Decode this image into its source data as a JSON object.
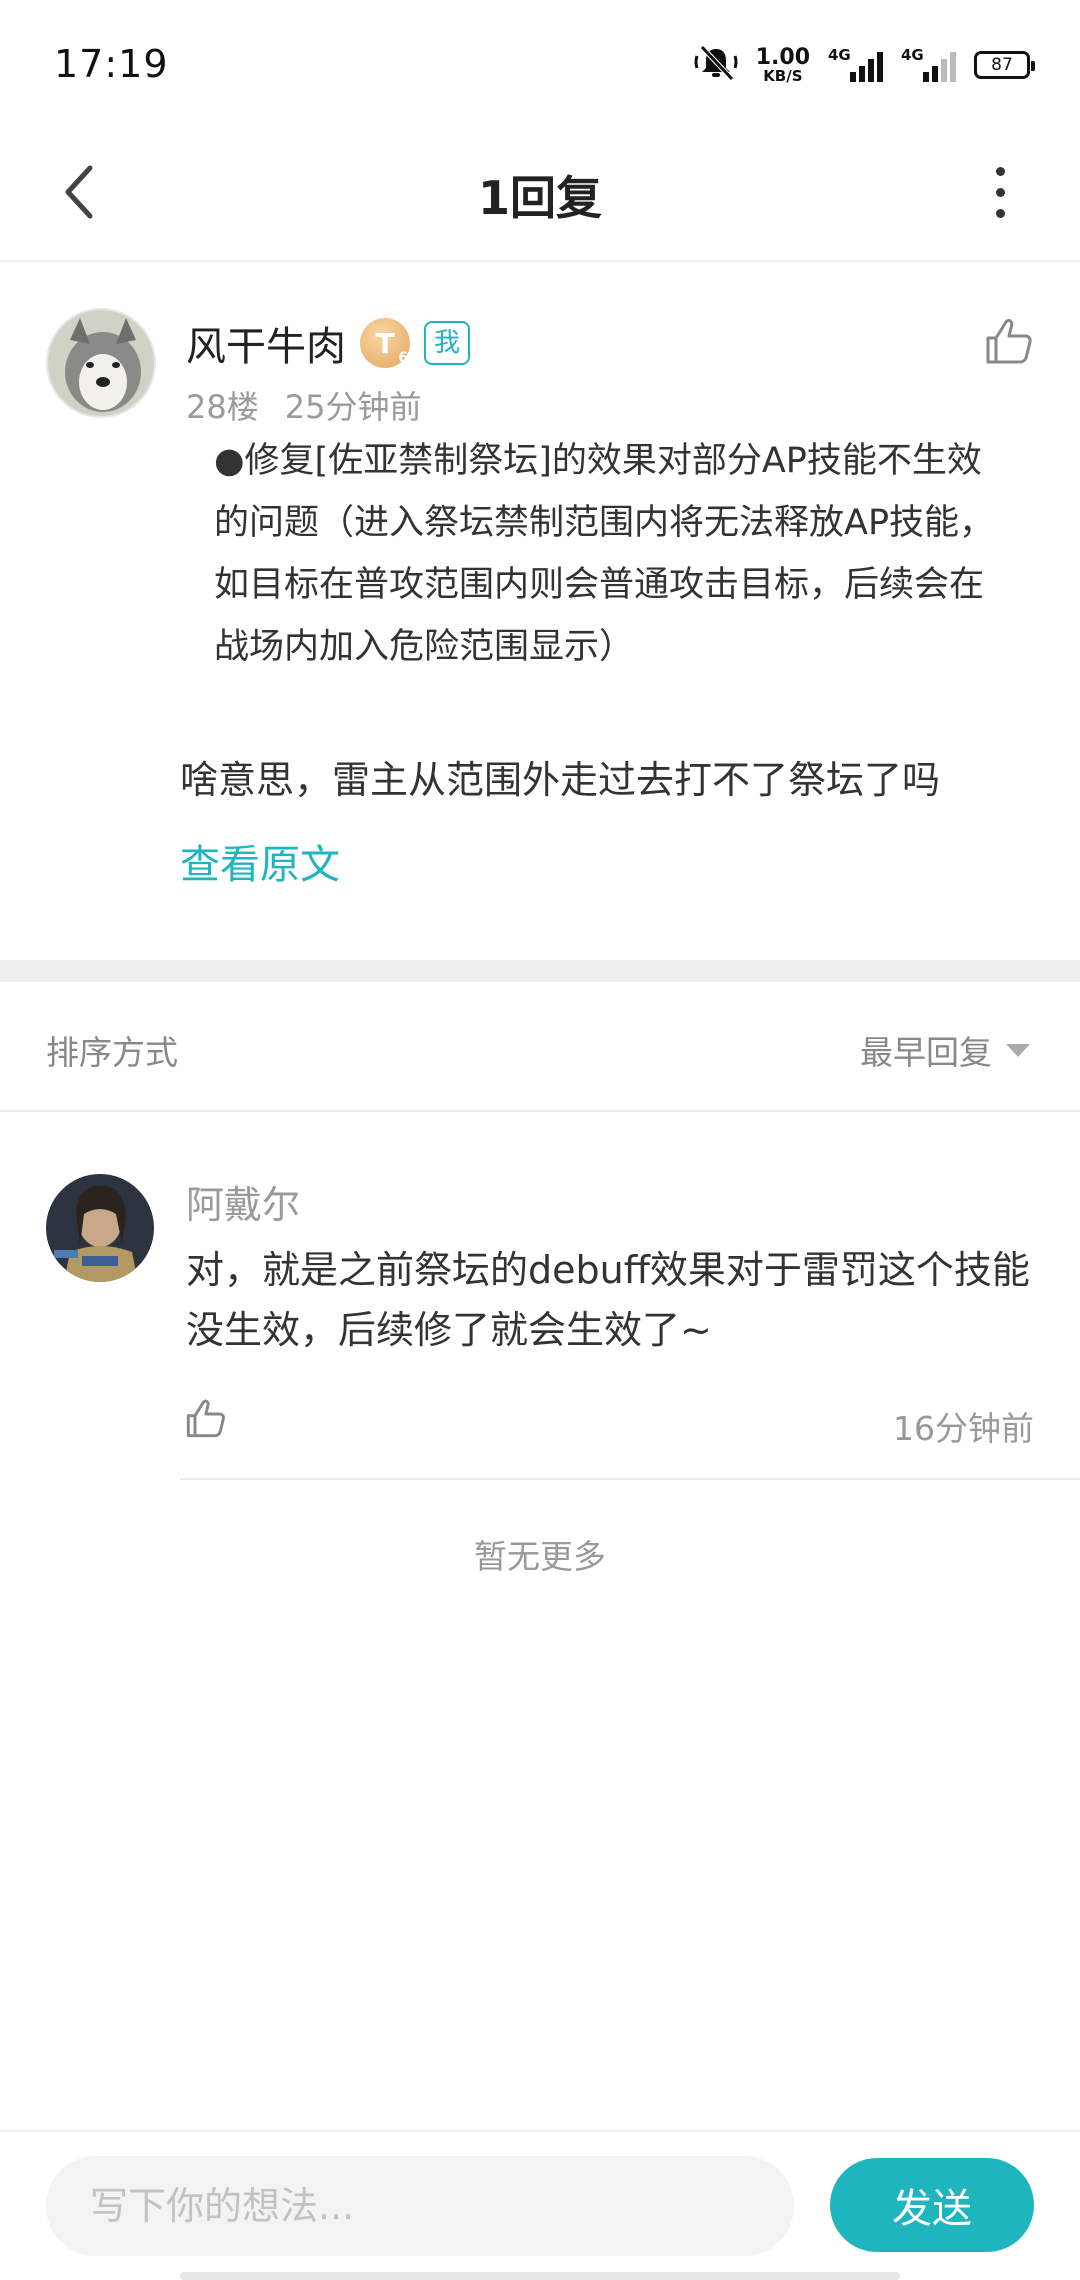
{
  "status_bar": {
    "time": "17:19",
    "net_speed_value": "1.00",
    "net_speed_unit": "KB/S",
    "signal1_label": "4G",
    "signal2_label": "4G",
    "battery": "87",
    "icons": [
      "bell-muted-icon",
      "signal-icon",
      "battery-icon"
    ]
  },
  "header": {
    "title": "1回复"
  },
  "main_comment": {
    "author": "风干牛肉",
    "level_letter": "T",
    "level_number": "6",
    "me_badge": "我",
    "floor": "28楼",
    "time": "25分钟前",
    "quote_text": "●修复[佐亚禁制祭坛]的效果对部分AP技能不生效的问题（进入祭坛禁制范围内将无法释放AP技能，如目标在普攻范围内则会普通攻击目标，后续会在战场内加入危险范围显示）",
    "reply_text": "啥意思，雷主从范围外走过去打不了祭坛了吗",
    "view_original": "查看原文"
  },
  "sort": {
    "label": "排序方式",
    "selected": "最早回复"
  },
  "replies": [
    {
      "author": "阿戴尔",
      "text": "对，就是之前祭坛的debuff效果对于雷罚这个技能没生效，后续修了就会生效了~",
      "time": "16分钟前"
    }
  ],
  "footer_note": "暂无更多",
  "composer": {
    "placeholder": "写下你的想法...",
    "send_label": "发送"
  },
  "colors": {
    "accent": "#1fb5bf",
    "muted_text": "#999999",
    "divider": "#eeeeee"
  }
}
